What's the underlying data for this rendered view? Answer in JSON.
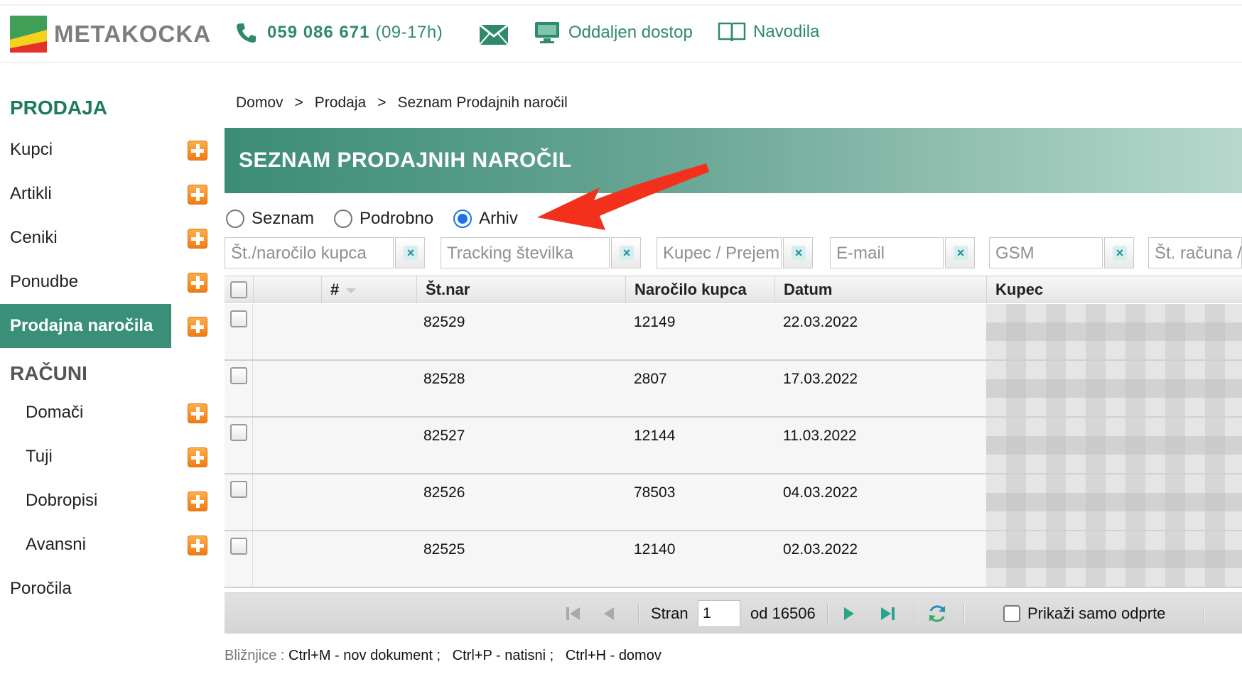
{
  "header": {
    "logo_text": "METAKOCKA",
    "phone_number": "059 086 671",
    "phone_hours": "(09-17h)",
    "remote_access_label": "Oddaljen dostop",
    "manual_label": "Navodila"
  },
  "sidebar": {
    "section_sales": "PRODAJA",
    "sales_items": [
      {
        "label": "Kupci",
        "has_add": true
      },
      {
        "label": "Artikli",
        "has_add": true
      },
      {
        "label": "Ceniki",
        "has_add": true
      },
      {
        "label": "Ponudbe",
        "has_add": true
      },
      {
        "label": "Prodajna naročila",
        "has_add": true,
        "active": true
      }
    ],
    "section_invoices": "RAČUNI",
    "invoice_items": [
      {
        "label": "Domači",
        "has_add": true
      },
      {
        "label": "Tuji",
        "has_add": true
      },
      {
        "label": "Dobropisi",
        "has_add": true
      },
      {
        "label": "Avansni",
        "has_add": true
      }
    ],
    "reports_label": "Poročila"
  },
  "breadcrumb": [
    "Domov",
    "Prodaja",
    "Seznam Prodajnih naročil"
  ],
  "breadcrumb_sep": ">",
  "page_title": "SEZNAM PRODAJNIH NAROČIL",
  "view_options": [
    {
      "label": "Seznam",
      "selected": false
    },
    {
      "label": "Podrobno",
      "selected": false
    },
    {
      "label": "Arhiv",
      "selected": true
    }
  ],
  "filters": [
    {
      "placeholder": "Št./naročilo kupca"
    },
    {
      "placeholder": "Tracking številka"
    },
    {
      "placeholder": "Kupec / Prejem"
    },
    {
      "placeholder": "E-mail"
    },
    {
      "placeholder": "GSM"
    },
    {
      "placeholder": "Št. računa /"
    }
  ],
  "clear_glyph": "×",
  "table": {
    "columns": [
      "#",
      "Št.nar",
      "Naročilo kupca",
      "Datum",
      "Kupec"
    ],
    "rows": [
      {
        "order_no": "82529",
        "customer_order": "12149",
        "date": "22.03.2022"
      },
      {
        "order_no": "82528",
        "customer_order": "2807",
        "date": "17.03.2022"
      },
      {
        "order_no": "82527",
        "customer_order": "12144",
        "date": "11.03.2022"
      },
      {
        "order_no": "82526",
        "customer_order": "78503",
        "date": "04.03.2022"
      },
      {
        "order_no": "82525",
        "customer_order": "12140",
        "date": "02.03.2022"
      }
    ]
  },
  "pager": {
    "page_label": "Stran",
    "page_value": "1",
    "total_label": "od 16506",
    "open_only_label": "Prikaži samo odprte"
  },
  "shortcuts": {
    "prefix": "Bližnjice :",
    "text": "Ctrl+M - nov dokument ;   Ctrl+P - natisni ;   Ctrl+H - domov"
  },
  "colors": {
    "brand_green": "#3a8f78",
    "accent_orange": "#f07a10",
    "annotation_red": "#f2301c",
    "radio_blue": "#1a73e8"
  }
}
